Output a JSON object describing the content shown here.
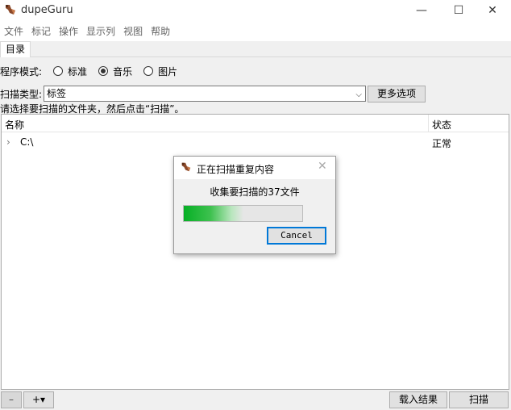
{
  "window": {
    "title": "dupeGuru",
    "minimize": "—",
    "maximize": "☐",
    "close": "✕"
  },
  "menu": [
    "文件",
    "标记",
    "操作",
    "显示列",
    "视图",
    "帮助"
  ],
  "tabs": [
    {
      "label": "目录"
    }
  ],
  "mode": {
    "label": "程序模式:",
    "options": [
      {
        "label": "标准",
        "checked": false
      },
      {
        "label": "音乐",
        "checked": true
      },
      {
        "label": "图片",
        "checked": false
      }
    ]
  },
  "scan_type": {
    "label": "扫描类型:",
    "selected": "标签",
    "more_options": "更多选项"
  },
  "hint": "请选择要扫描的文件夹，然后点击“扫描”。",
  "tree": {
    "columns": {
      "name": "名称",
      "status": "状态"
    },
    "rows": [
      {
        "name": "C:\\",
        "status": "正常"
      }
    ]
  },
  "bottom": {
    "remove": "–",
    "add": "+▾",
    "load_results": "载入结果",
    "scan": "扫描"
  },
  "dialog": {
    "title": "正在扫描重复内容",
    "message": "收集要扫描的37文件",
    "progress": 0.5,
    "cancel": "Cancel"
  },
  "colors": {
    "progress_green": "#06b025",
    "focus_blue": "#0078d7"
  }
}
